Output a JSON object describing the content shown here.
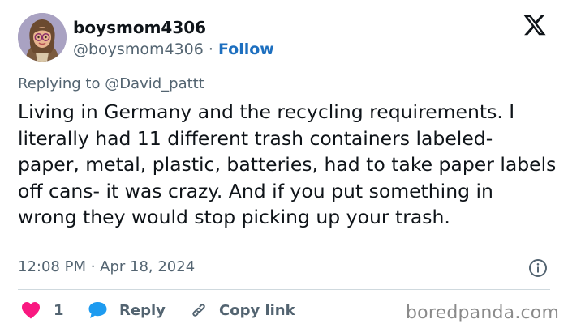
{
  "author": {
    "display_name": "boysmom4306",
    "handle": "@boysmom4306",
    "separator": "·",
    "follow_label": "Follow"
  },
  "reply_to": {
    "label": "Replying to @David_pattt"
  },
  "tweet": {
    "text": "Living in Germany and the recycling requirements. I literally had 11 different trash containers labeled- paper, metal, plastic, batteries, had to take paper labels off cans- it was crazy. And if you put something in wrong they would stop picking up your trash.",
    "timestamp": "12:08 PM · Apr 18, 2024"
  },
  "actions": {
    "like_count": "1",
    "reply_label": "Reply",
    "copy_link_label": "Copy link"
  },
  "watermark": "boredpanda.com",
  "icons": {
    "logo": "x-logo-icon",
    "info": "info-icon",
    "like": "heart-icon",
    "reply": "speech-bubble-icon",
    "copy": "link-icon"
  },
  "colors": {
    "text": "#0f1419",
    "muted": "#536471",
    "follow": "#1d6fbf",
    "like": "#f91880",
    "reply": "#1d9bf0",
    "divider": "#cfd9de"
  }
}
